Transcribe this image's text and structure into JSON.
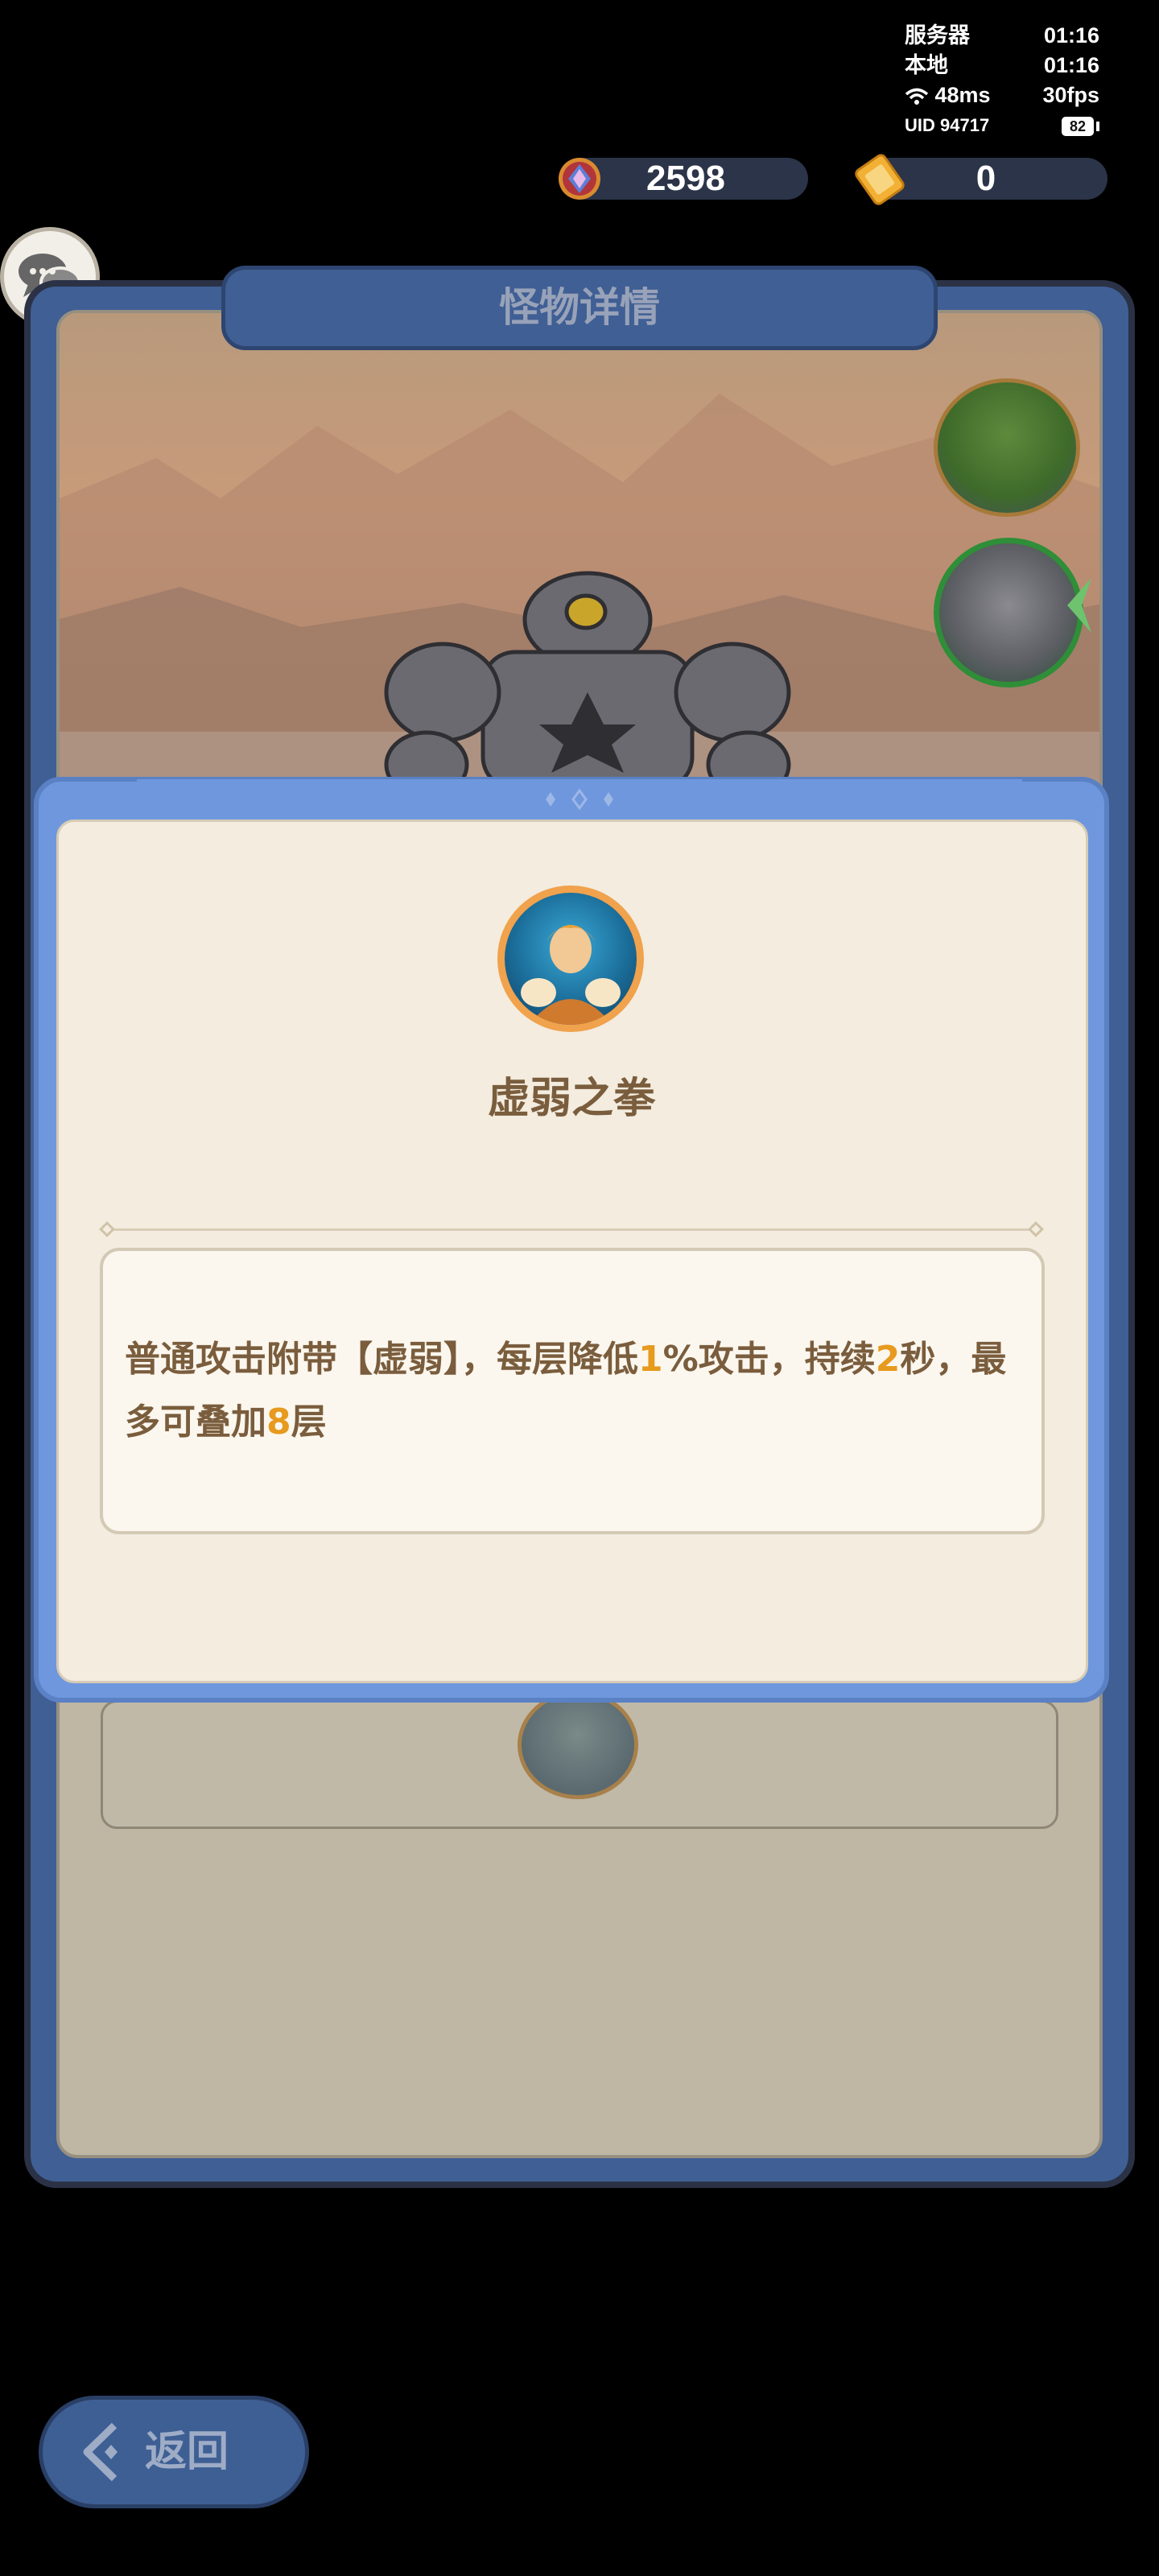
{
  "status": {
    "server_label": "服务器",
    "server_time": "01:16",
    "local_label": "本地",
    "local_time": "01:16",
    "ping": "48ms",
    "fps": "30fps",
    "uid": "UID 94717",
    "battery": "82"
  },
  "currency": {
    "gems": "2598",
    "tickets": "0"
  },
  "panel": {
    "title": "怪物详情"
  },
  "skill": {
    "name": "虚弱之拳",
    "description_parts": [
      {
        "text": "普通攻击附带【虚弱】，每层降低",
        "highlight": false
      },
      {
        "text": "1",
        "highlight": true
      },
      {
        "text": "%攻击，持续",
        "highlight": false
      },
      {
        "text": "2",
        "highlight": true
      },
      {
        "text": "秒，最多可叠加",
        "highlight": false
      },
      {
        "text": "8",
        "highlight": true
      },
      {
        "text": "层",
        "highlight": false
      }
    ]
  },
  "back_button": {
    "label": "返回"
  },
  "icons": [
    "gem-icon",
    "ticket-icon",
    "chat-icon",
    "wifi-icon",
    "battery-icon",
    "skill-fist-icon",
    "back-arrow-icon",
    "monster-golem-icon",
    "island-map-icon"
  ],
  "colors": {
    "frame_blue": "#3f5f95",
    "modal_blue": "#6f97dd",
    "parchment": "#f3ecdf",
    "text_brown": "#7a5d3d",
    "highlight_orange": "#e69a1e"
  }
}
